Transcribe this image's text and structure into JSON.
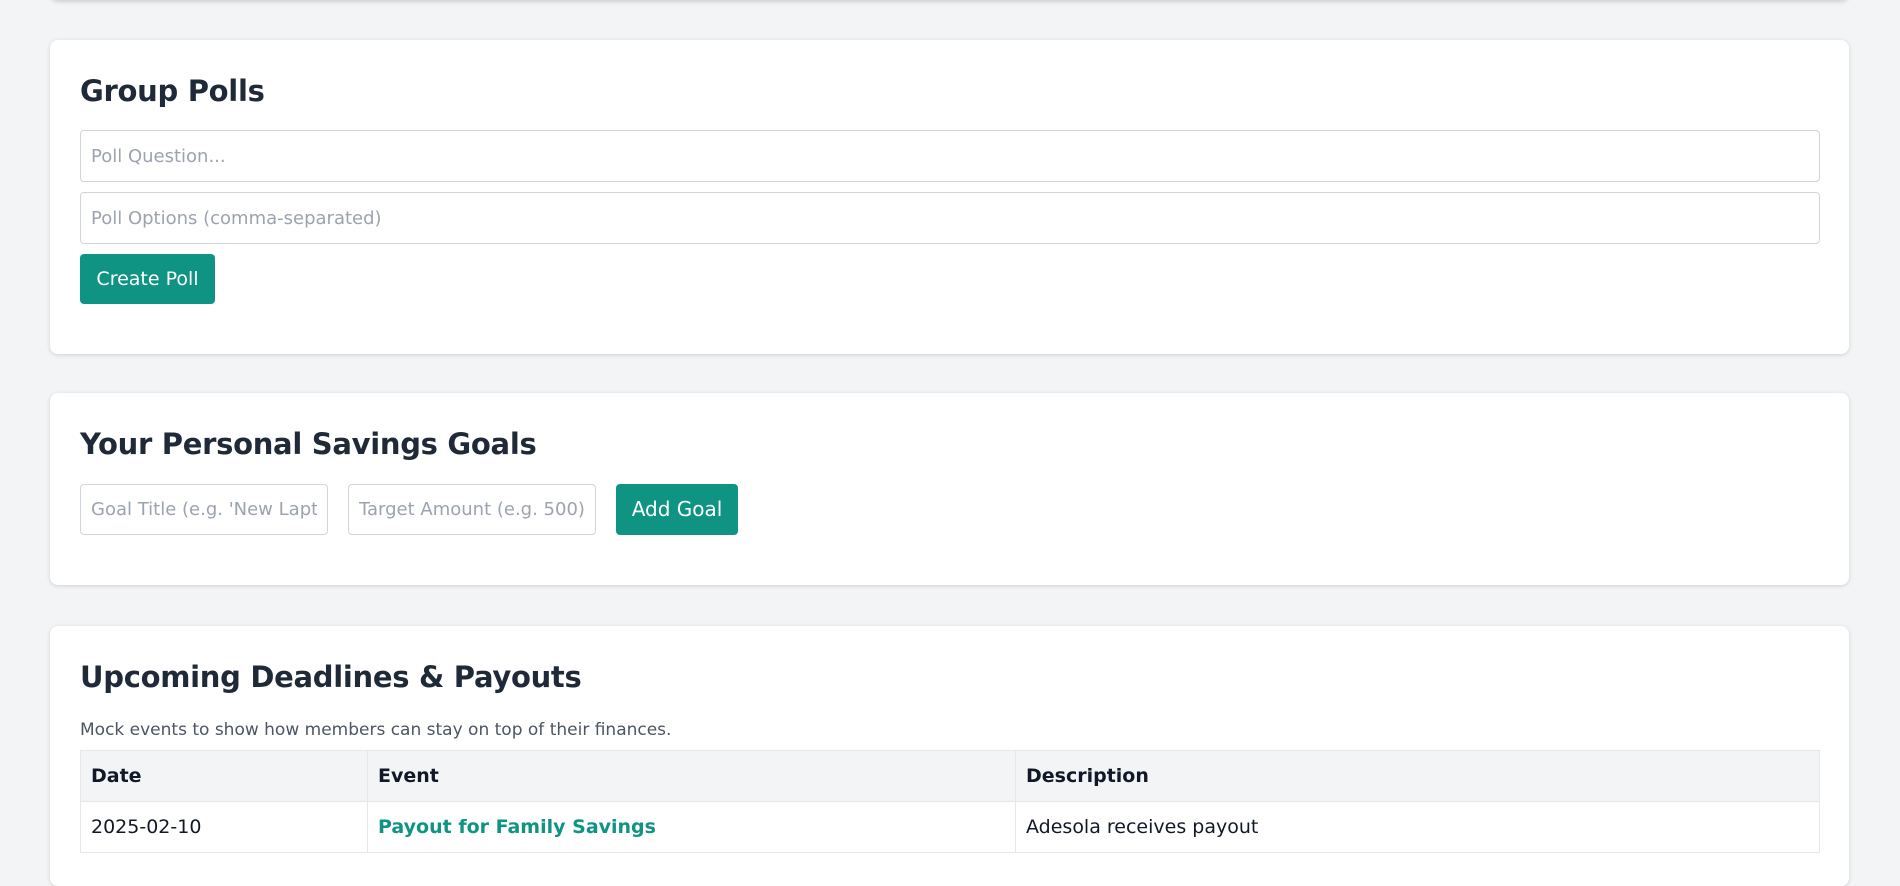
{
  "polls": {
    "title": "Group Polls",
    "question_placeholder": "Poll Question...",
    "options_placeholder": "Poll Options (comma-separated)",
    "create_label": "Create Poll"
  },
  "goals": {
    "title": "Your Personal Savings Goals",
    "title_placeholder": "Goal Title (e.g. 'New Laptop')",
    "amount_placeholder": "Target Amount (e.g. 500)",
    "add_label": "Add Goal"
  },
  "deadlines": {
    "title": "Upcoming Deadlines & Payouts",
    "caption": "Mock events to show how members can stay on top of their finances.",
    "headers": [
      "Date",
      "Event",
      "Description"
    ],
    "rows": [
      {
        "date": "2025-02-10",
        "event": "Payout for Family Savings",
        "description": "Adesola receives payout"
      }
    ]
  },
  "colors": {
    "accent": "#0f9484",
    "page_background": "#f3f4f6",
    "heading": "#1f2937"
  }
}
